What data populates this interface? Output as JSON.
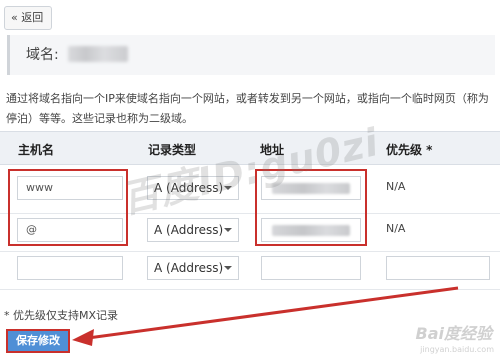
{
  "header": {
    "back_label": "« 返回"
  },
  "domain": {
    "label": "域名:"
  },
  "description": "通过将域名指向一个IP来使域名指向一个网站，或者转发到另一个网站，或指向一个临时网页（称为停泊）等等。这些记录也称为二级域。",
  "table": {
    "columns": [
      "主机名",
      "记录类型",
      "地址",
      "优先级 *"
    ],
    "rows": [
      {
        "host": "www",
        "type": "A (Address)",
        "priority": "N/A"
      },
      {
        "host": "@",
        "type": "A (Address)",
        "priority": "N/A"
      },
      {
        "host": "",
        "type": "A (Address)",
        "priority": ""
      }
    ]
  },
  "footnote": "* 优先级仅支持MX记录",
  "save_label": "保存修改",
  "watermark": "百度ID:gu0zi",
  "baidu_logo": "Bai度经验",
  "baidu_url": "jingyan.baidu.com",
  "colors": {
    "accent": "#4f8fd6",
    "highlight": "#c9302c",
    "header_bg": "#eef1f5"
  },
  "icons": {
    "caret": "chevron-down-icon",
    "arrow": "arrow-annotation"
  }
}
